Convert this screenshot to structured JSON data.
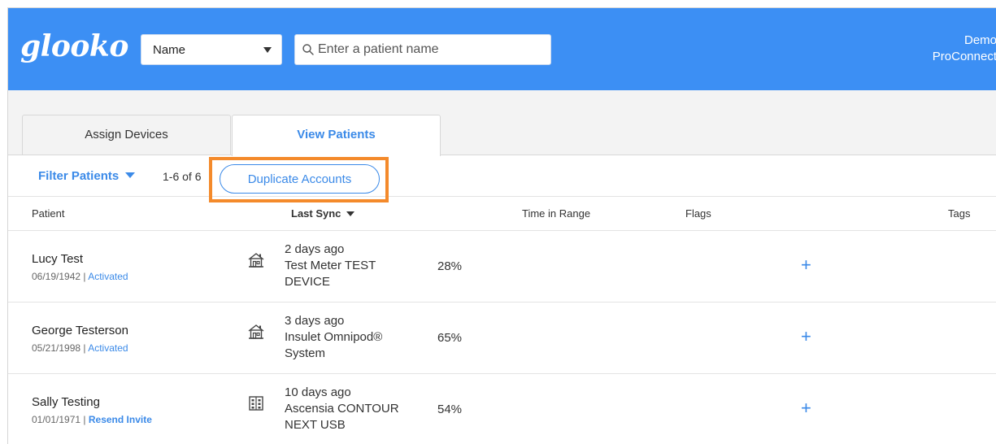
{
  "header": {
    "logo": "glooko",
    "search_by": {
      "selected": "Name"
    },
    "search": {
      "placeholder": "Enter a patient name",
      "value": ""
    },
    "user": {
      "line1": "Demo",
      "line2": "ProConnect"
    },
    "background_color": "#3c8ff4"
  },
  "tabs": [
    {
      "label": "Assign Devices",
      "active": false
    },
    {
      "label": "View Patients",
      "active": true
    }
  ],
  "toolbar": {
    "filter_label": "Filter Patients",
    "count": "1-6 of 6",
    "duplicate_label": "Duplicate Accounts",
    "highlight_color": "#f48a2b"
  },
  "table": {
    "columns": {
      "patient": "Patient",
      "last_sync": "Last Sync",
      "time_in_range": "Time in Range",
      "flags": "Flags",
      "tags": "Tags"
    },
    "rows": [
      {
        "name": "Lucy Test",
        "dob": "06/19/1942",
        "status": "Activated",
        "location_icon": "home-icon",
        "sync_time": "2 days ago",
        "device": "Test Meter TEST DEVICE",
        "time_in_range": "28%"
      },
      {
        "name": "George Testerson",
        "dob": "05/21/1998",
        "status": "Activated",
        "location_icon": "home-icon",
        "sync_time": "3 days ago",
        "device": "Insulet Omnipod® System",
        "time_in_range": "65%"
      },
      {
        "name": "Sally Testing",
        "dob": "01/01/1971",
        "status": "Resend Invite",
        "location_icon": "clinic-building-icon",
        "sync_time": "10 days ago",
        "device": "Ascensia CONTOUR NEXT USB",
        "time_in_range": "54%"
      }
    ],
    "add_tag_symbol": "+"
  },
  "colors": {
    "accent": "#3b8ae8"
  }
}
